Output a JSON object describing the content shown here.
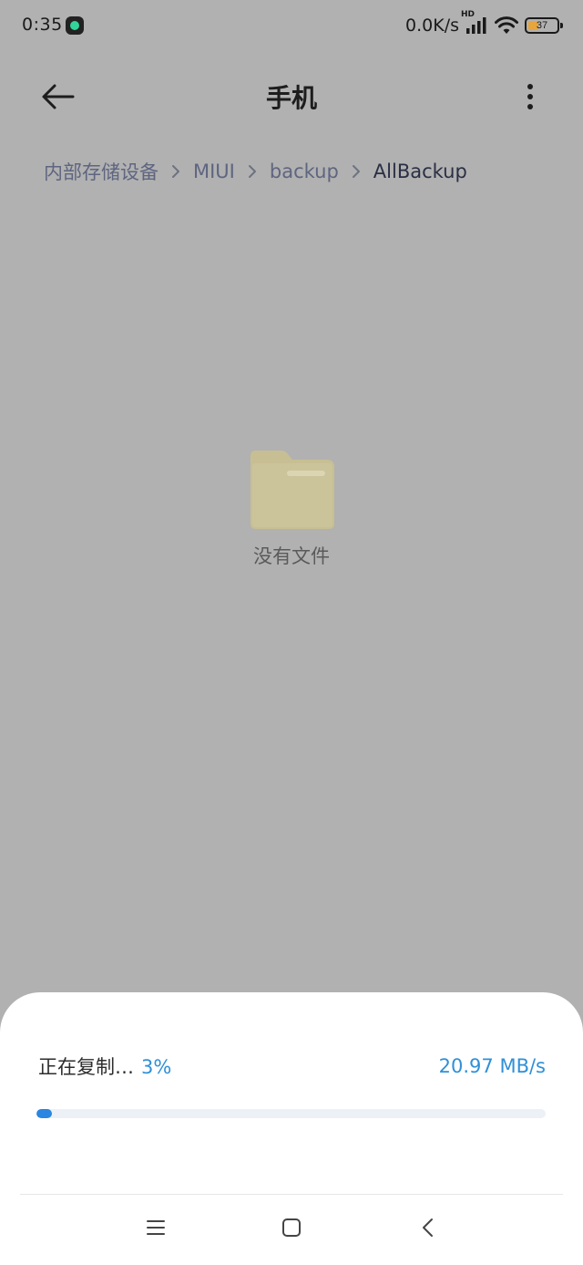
{
  "status_bar": {
    "time": "0:35",
    "net_speed": "0.0K/s",
    "network_badge": "HD",
    "battery_level": "37",
    "battery_fraction": 0.37,
    "battery_color": "#e8a53a",
    "icons": [
      "app-notification-icon",
      "signal-icon",
      "wifi-icon",
      "battery-icon"
    ]
  },
  "header": {
    "title": "手机",
    "back_icon": "back-arrow-icon",
    "more_icon": "more-vertical-icon"
  },
  "breadcrumb": {
    "items": [
      "内部存储设备",
      "MIUI",
      "backup",
      "AllBackup"
    ],
    "separator_icon": "chevron-right-icon"
  },
  "empty_state": {
    "icon": "folder-icon",
    "text": "没有文件"
  },
  "copy_progress": {
    "label": "正在复制…",
    "percent_text": "3%",
    "percent": 3,
    "speed": "20.97 MB/s",
    "accent_color": "#2f90d8"
  },
  "nav_bar": {
    "icons": [
      "menu-icon",
      "home-icon",
      "back-icon"
    ]
  }
}
